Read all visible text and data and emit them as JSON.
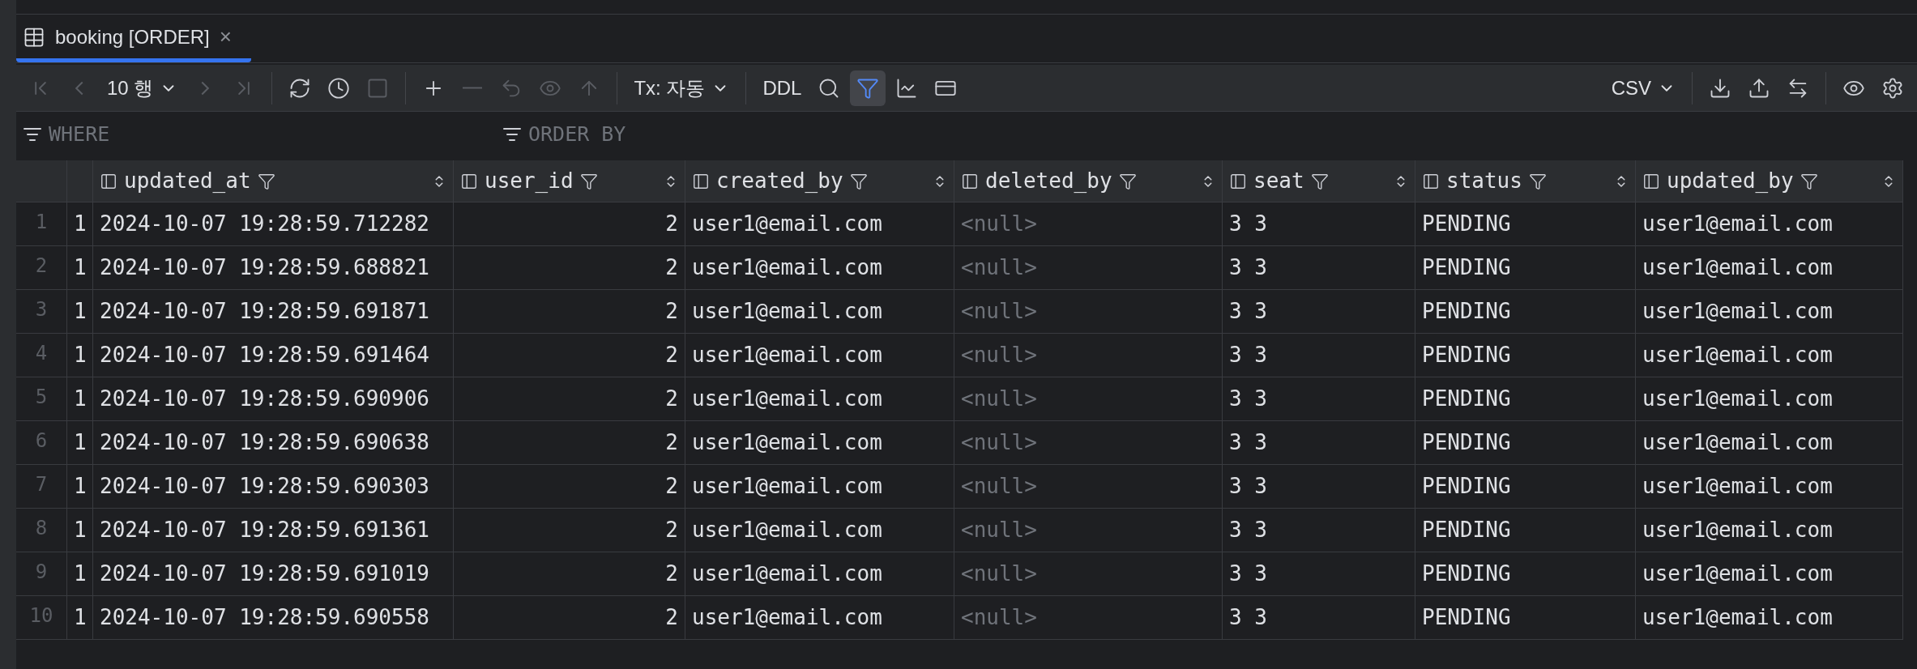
{
  "tab": {
    "title": "booking [ORDER]",
    "selected": true,
    "close": "×"
  },
  "toolbar": {
    "left": [
      {
        "kind": "icon",
        "disabled": true
      },
      {
        "kind": "icon",
        "disabled": true
      },
      {
        "kind": "dropdown",
        "label": "10 행",
        "disabled": false
      },
      {
        "kind": "icon",
        "disabled": true
      },
      {
        "kind": "icon",
        "disabled": true
      },
      {
        "kind": "separator"
      },
      {
        "kind": "icon",
        "disabled": false
      },
      {
        "kind": "icon",
        "disabled": false
      },
      {
        "kind": "icon",
        "disabled": true
      },
      {
        "kind": "separator"
      },
      {
        "kind": "icon",
        "disabled": false
      },
      {
        "kind": "icon",
        "disabled": true
      },
      {
        "kind": "icon",
        "disabled": true
      },
      {
        "kind": "icon",
        "disabled": true
      },
      {
        "kind": "icon",
        "disabled": true
      },
      {
        "kind": "separator"
      },
      {
        "kind": "dropdown",
        "label": "Tx: 자동",
        "disabled": false
      },
      {
        "kind": "separator"
      },
      {
        "kind": "text",
        "label": "DDL",
        "disabled": false
      },
      {
        "kind": "icon",
        "disabled": false
      },
      {
        "kind": "icon",
        "disabled": false,
        "selected": true
      },
      {
        "kind": "icon",
        "disabled": false,
        "selected": false
      },
      {
        "kind": "icon",
        "disabled": false,
        "selected": false
      }
    ],
    "right": [
      {
        "kind": "dropdown",
        "label": "CSV",
        "disabled": false
      },
      {
        "kind": "separator"
      },
      {
        "kind": "icon",
        "disabled": false
      },
      {
        "kind": "icon",
        "disabled": false
      },
      {
        "kind": "icon",
        "disabled": false
      },
      {
        "kind": "separator"
      },
      {
        "kind": "icon",
        "disabled": false
      },
      {
        "kind": "icon",
        "disabled": false
      }
    ]
  },
  "filter": {
    "where_placeholder": "WHERE",
    "order_placeholder": "ORDER BY"
  },
  "table": {
    "columns": [
      {
        "kind": "unnamed"
      },
      {
        "name": "updated_at",
        "kind": "text"
      },
      {
        "name": "user_id",
        "kind": "number"
      },
      {
        "name": "created_by",
        "kind": "text"
      },
      {
        "name": "deleted_by",
        "kind": "text"
      },
      {
        "name": "seat",
        "kind": "text"
      },
      {
        "name": "status",
        "kind": "text"
      },
      {
        "name": "updated_by",
        "kind": "text"
      }
    ],
    "rows": [
      {
        "number": "1",
        "cells": [
          {
            "text": "1",
            "is_null": false
          },
          {
            "text": "2024-10-07 19:28:59.712282",
            "is_null": false
          },
          {
            "text": "2",
            "is_null": false
          },
          {
            "text": "user1@email.com",
            "is_null": false
          },
          {
            "text": "<null>",
            "is_null": true
          },
          {
            "text": "3 3",
            "is_null": false
          },
          {
            "text": "PENDING",
            "is_null": false
          },
          {
            "text": "user1@email.com",
            "is_null": false
          }
        ]
      },
      {
        "number": "2",
        "cells": [
          {
            "text": "1",
            "is_null": false
          },
          {
            "text": "2024-10-07 19:28:59.688821",
            "is_null": false
          },
          {
            "text": "2",
            "is_null": false
          },
          {
            "text": "user1@email.com",
            "is_null": false
          },
          {
            "text": "<null>",
            "is_null": true
          },
          {
            "text": "3 3",
            "is_null": false
          },
          {
            "text": "PENDING",
            "is_null": false
          },
          {
            "text": "user1@email.com",
            "is_null": false
          }
        ]
      },
      {
        "number": "3",
        "cells": [
          {
            "text": "1",
            "is_null": false
          },
          {
            "text": "2024-10-07 19:28:59.691871",
            "is_null": false
          },
          {
            "text": "2",
            "is_null": false
          },
          {
            "text": "user1@email.com",
            "is_null": false
          },
          {
            "text": "<null>",
            "is_null": true
          },
          {
            "text": "3 3",
            "is_null": false
          },
          {
            "text": "PENDING",
            "is_null": false
          },
          {
            "text": "user1@email.com",
            "is_null": false
          }
        ]
      },
      {
        "number": "4",
        "cells": [
          {
            "text": "1",
            "is_null": false
          },
          {
            "text": "2024-10-07 19:28:59.691464",
            "is_null": false
          },
          {
            "text": "2",
            "is_null": false
          },
          {
            "text": "user1@email.com",
            "is_null": false
          },
          {
            "text": "<null>",
            "is_null": true
          },
          {
            "text": "3 3",
            "is_null": false
          },
          {
            "text": "PENDING",
            "is_null": false
          },
          {
            "text": "user1@email.com",
            "is_null": false
          }
        ]
      },
      {
        "number": "5",
        "cells": [
          {
            "text": "1",
            "is_null": false
          },
          {
            "text": "2024-10-07 19:28:59.690906",
            "is_null": false
          },
          {
            "text": "2",
            "is_null": false
          },
          {
            "text": "user1@email.com",
            "is_null": false
          },
          {
            "text": "<null>",
            "is_null": true
          },
          {
            "text": "3 3",
            "is_null": false
          },
          {
            "text": "PENDING",
            "is_null": false
          },
          {
            "text": "user1@email.com",
            "is_null": false
          }
        ]
      },
      {
        "number": "6",
        "cells": [
          {
            "text": "1",
            "is_null": false
          },
          {
            "text": "2024-10-07 19:28:59.690638",
            "is_null": false
          },
          {
            "text": "2",
            "is_null": false
          },
          {
            "text": "user1@email.com",
            "is_null": false
          },
          {
            "text": "<null>",
            "is_null": true
          },
          {
            "text": "3 3",
            "is_null": false
          },
          {
            "text": "PENDING",
            "is_null": false
          },
          {
            "text": "user1@email.com",
            "is_null": false
          }
        ]
      },
      {
        "number": "7",
        "cells": [
          {
            "text": "1",
            "is_null": false
          },
          {
            "text": "2024-10-07 19:28:59.690303",
            "is_null": false
          },
          {
            "text": "2",
            "is_null": false
          },
          {
            "text": "user1@email.com",
            "is_null": false
          },
          {
            "text": "<null>",
            "is_null": true
          },
          {
            "text": "3 3",
            "is_null": false
          },
          {
            "text": "PENDING",
            "is_null": false
          },
          {
            "text": "user1@email.com",
            "is_null": false
          }
        ]
      },
      {
        "number": "8",
        "cells": [
          {
            "text": "1",
            "is_null": false
          },
          {
            "text": "2024-10-07 19:28:59.691361",
            "is_null": false
          },
          {
            "text": "2",
            "is_null": false
          },
          {
            "text": "user1@email.com",
            "is_null": false
          },
          {
            "text": "<null>",
            "is_null": true
          },
          {
            "text": "3 3",
            "is_null": false
          },
          {
            "text": "PENDING",
            "is_null": false
          },
          {
            "text": "user1@email.com",
            "is_null": false
          }
        ]
      },
      {
        "number": "9",
        "cells": [
          {
            "text": "1",
            "is_null": false
          },
          {
            "text": "2024-10-07 19:28:59.691019",
            "is_null": false
          },
          {
            "text": "2",
            "is_null": false
          },
          {
            "text": "user1@email.com",
            "is_null": false
          },
          {
            "text": "<null>",
            "is_null": true
          },
          {
            "text": "3 3",
            "is_null": false
          },
          {
            "text": "PENDING",
            "is_null": false
          },
          {
            "text": "user1@email.com",
            "is_null": false
          }
        ]
      },
      {
        "number": "10",
        "cells": [
          {
            "text": "1",
            "is_null": false
          },
          {
            "text": "2024-10-07 19:28:59.690558",
            "is_null": false
          },
          {
            "text": "2",
            "is_null": false
          },
          {
            "text": "user1@email.com",
            "is_null": false
          },
          {
            "text": "<null>",
            "is_null": true
          },
          {
            "text": "3 3",
            "is_null": false
          },
          {
            "text": "PENDING",
            "is_null": false
          },
          {
            "text": "user1@email.com",
            "is_null": false
          }
        ]
      }
    ]
  }
}
